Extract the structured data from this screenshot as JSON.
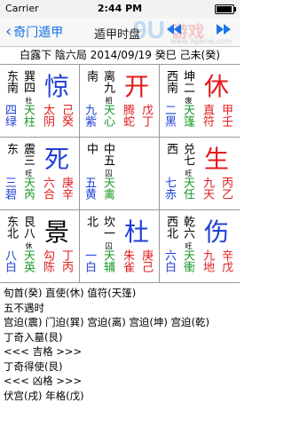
{
  "status_bar": {
    "carrier": "Carrier",
    "time": "2:44 PM"
  },
  "nav": {
    "back_label": "奇门遁甲",
    "title": "遁甲时盘",
    "prev_icon": "rewind-icon",
    "next_icon": "fast-forward-icon",
    "watermark": {
      "brand_number": "9U",
      "brand_text": "游戏",
      "site": "www.9game.com"
    }
  },
  "info_line": "白露下 陰六局 2014/09/19 癸巳 己未(癸)",
  "colors": {
    "blue": "#1f3fd6",
    "red": "#e21b1b",
    "green": "#1a9a2a",
    "accent": "#1a73e8"
  },
  "grid": [
    {
      "dir_top": "东南",
      "trigram": "巽四",
      "trigram_sub": "杜",
      "god": "惊",
      "god_color": "#1f3fd6",
      "bottom": [
        "四绿",
        "天柱",
        "太阴",
        "己癸"
      ]
    },
    {
      "dir_top": "南",
      "trigram": "离九",
      "trigram_sub": "相",
      "god": "开",
      "god_color": "#e21b1b",
      "bottom": [
        "九紫",
        "天心",
        "腾蛇",
        "戊丁"
      ]
    },
    {
      "dir_top": "西南",
      "trigram": "坤二",
      "trigram_sub": "废",
      "god": "休",
      "god_color": "#e21b1b",
      "bottom": [
        "二黑",
        "天篷",
        "直符",
        "甲壬"
      ]
    },
    {
      "dir_top": "东",
      "trigram": "震三",
      "trigram_sub": "旺",
      "god": "死",
      "god_color": "#1f3fd6",
      "bottom": [
        "三碧",
        "天芮",
        "六合",
        "庚辛"
      ]
    },
    {
      "dir_top": "中",
      "trigram": "中五",
      "trigram_sub": "囚",
      "god": "",
      "god_color": "#000000",
      "bottom": [
        "五黄",
        "天禽",
        "",
        ""
      ]
    },
    {
      "dir_top": "西",
      "trigram": "兑七",
      "trigram_sub": "旺",
      "god": "生",
      "god_color": "#e21b1b",
      "bottom": [
        "七赤",
        "天任",
        "九天",
        "丙乙"
      ]
    },
    {
      "dir_top": "东北",
      "trigram": "艮八",
      "trigram_sub": "休",
      "god": "景",
      "god_color": "#000000",
      "bottom": [
        "八白",
        "天英",
        "勾陈",
        "丁丙"
      ]
    },
    {
      "dir_top": "北",
      "trigram": "坎一",
      "trigram_sub": "囚",
      "god": "杜",
      "god_color": "#1f3fd6",
      "bottom": [
        "一白",
        "天辅",
        "朱雀",
        "庚己"
      ]
    },
    {
      "dir_top": "西北",
      "trigram": "乾六",
      "trigram_sub": "旺",
      "god": "伤",
      "god_color": "#1f3fd6",
      "bottom": [
        "六白",
        "天衝",
        "九地",
        "辛戊"
      ]
    }
  ],
  "details": [
    "旬首(癸) 直使(休) 值符(天篷)",
    "五不遇时",
    "宫迫(震) 门迫(巽) 宫迫(离) 宫迫(坤) 宫迫(乾)",
    "丁奇入墓(艮)",
    "<<< 吉格 >>>",
    "丁奇得使(艮)",
    "<<< 凶格 >>>",
    "伏宫(戌) 年格(戊)"
  ]
}
